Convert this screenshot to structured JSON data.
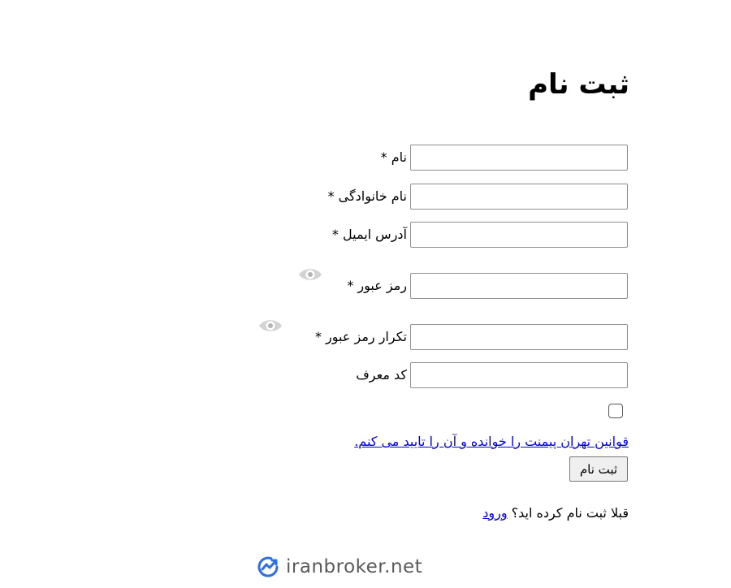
{
  "page": {
    "title": "ثبت نام"
  },
  "form": {
    "first_name": {
      "label": "نام *",
      "value": ""
    },
    "last_name": {
      "label": "نام خانوادگی *",
      "value": ""
    },
    "email": {
      "label": "آدرس ایمیل *",
      "value": ""
    },
    "password": {
      "label": "رمز عبور *",
      "value": ""
    },
    "password_confirm": {
      "label": "تکرار رمز عبور *",
      "value": ""
    },
    "referral": {
      "label": "کد معرف",
      "value": ""
    },
    "terms": {
      "checked": false,
      "link_text": "قوانین تهران پیمنت را خوانده و آن را تایید می کنم."
    },
    "submit_label": "ثبت نام"
  },
  "login": {
    "prompt": "قبلا ثبت نام کرده اید؟",
    "link_text": "ورود"
  },
  "logo": {
    "text": "iranbroker.net",
    "icon": "trend-chart-icon",
    "color": "#2f6fe0"
  },
  "colors": {
    "link": "#0000ee",
    "eye_icon": "#c8c8c8"
  }
}
